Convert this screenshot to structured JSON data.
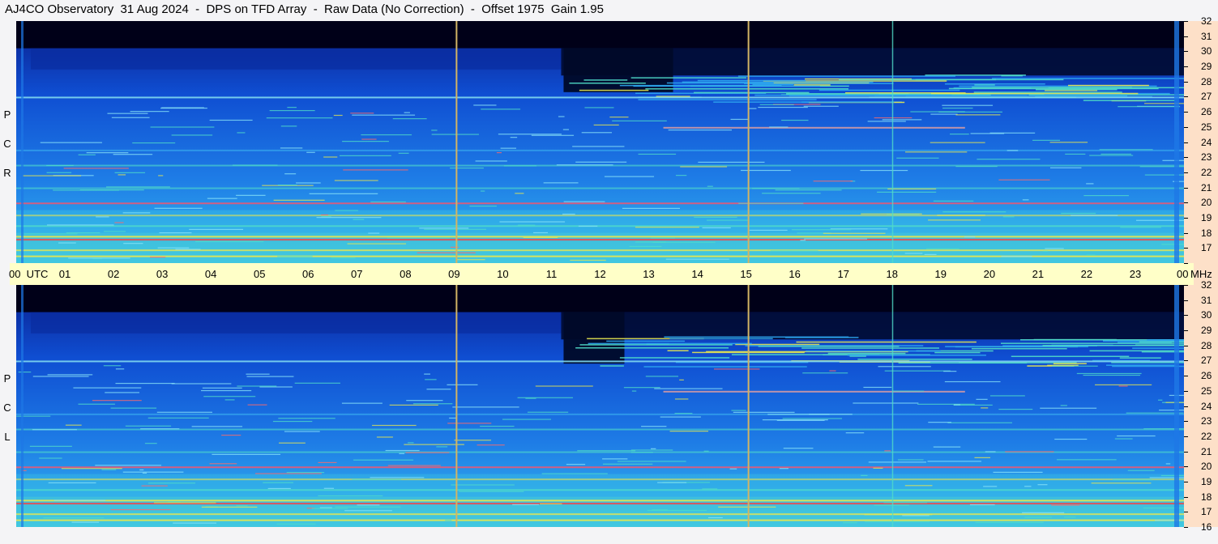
{
  "title": "AJ4CO Observatory  31 Aug 2024  -  DPS on TFD Array  -  Raw Data (No Correction)  -  Offset 1975  Gain 1.95",
  "panels": {
    "top": {
      "channel_letters": [
        "P",
        "C",
        "R"
      ]
    },
    "bottom": {
      "channel_letters": [
        "P",
        "C",
        "L"
      ]
    }
  },
  "time_axis": {
    "labels": [
      "00  UTC",
      "01",
      "02",
      "03",
      "04",
      "05",
      "06",
      "07",
      "08",
      "09",
      "10",
      "11",
      "12",
      "13",
      "14",
      "15",
      "16",
      "17",
      "18",
      "19",
      "20",
      "21",
      "22",
      "23",
      "00"
    ],
    "unit": "MHz"
  },
  "colors": {
    "background_quiet": "#000014",
    "background_mid": "#0a3cc8",
    "background_high": "#32b4f0",
    "noise_yellow": "#e6e650",
    "time_strip": "#ffffc8",
    "freq_strip": "#fde0c8",
    "marker_line": "#d2b464"
  },
  "chart_data": {
    "type": "heatmap",
    "title": "AJ4CO Observatory  31 Aug 2024  -  DPS on TFD Array  -  Raw Data (No Correction)  -  Offset 1975  Gain 1.95",
    "xlabel": "UTC",
    "ylabel": "MHz",
    "x_range": [
      0,
      24
    ],
    "x_ticks": [
      "00",
      "01",
      "02",
      "03",
      "04",
      "05",
      "06",
      "07",
      "08",
      "09",
      "10",
      "11",
      "12",
      "13",
      "14",
      "15",
      "16",
      "17",
      "18",
      "19",
      "20",
      "21",
      "22",
      "23",
      "00"
    ],
    "y_range": [
      16,
      32
    ],
    "y_ticks": [
      16,
      17,
      18,
      19,
      20,
      21,
      22,
      23,
      24,
      25,
      26,
      27,
      28,
      29,
      30,
      31,
      32
    ],
    "panels": [
      "RCP",
      "LCP"
    ],
    "vertical_markers_utc": [
      9.05,
      15.05
    ],
    "strong_bands_mhz": [
      27.0,
      25.0,
      20.0,
      17.6,
      16.5
    ],
    "colormap": [
      "#000014",
      "#0a3cc8",
      "#1e78e6",
      "#32b4f0",
      "#50dcc8",
      "#e6e650",
      "#ff3c3c"
    ]
  }
}
